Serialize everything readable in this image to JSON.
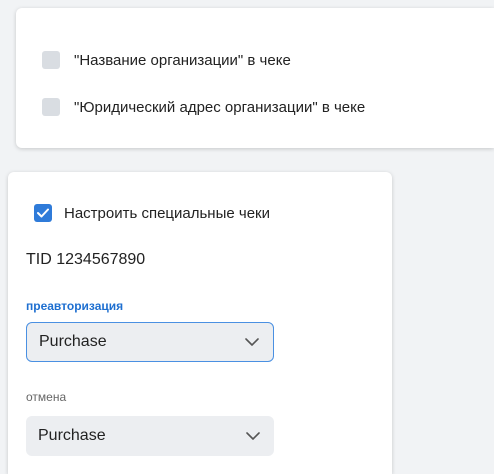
{
  "receipt_options": {
    "org_name_label": "\"Название организации\" в чеке",
    "org_address_label": "\"Юридический адрес организации\" в чеке",
    "org_name_checked": false,
    "org_address_checked": false
  },
  "special_receipts": {
    "toggle_label": "Настроить специальные чеки",
    "toggle_checked": true,
    "tid": "TID 1234567890",
    "preauth": {
      "label": "преавторизация",
      "value": "Purchase"
    },
    "cancel": {
      "label": "отмена",
      "value": "Purchase"
    }
  },
  "colors": {
    "accent": "#2f7bd9",
    "label_active": "#1e6fd0",
    "checkbox_off": "#d9dde2",
    "select_bg": "#eceef1"
  },
  "icons": [
    "checkmark-icon",
    "chevron-down-icon"
  ]
}
